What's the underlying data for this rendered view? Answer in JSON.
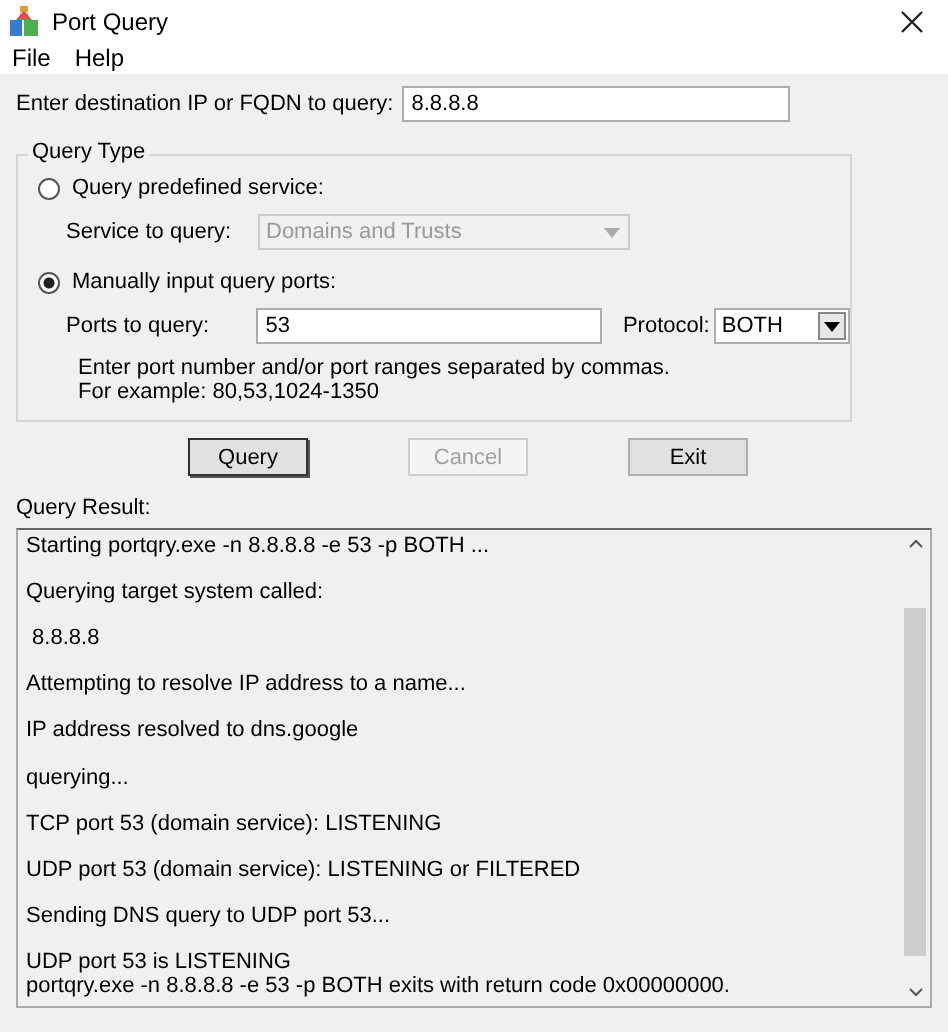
{
  "window": {
    "title": "Port Query"
  },
  "menu": [
    "File",
    "Help"
  ],
  "destination": {
    "label": "Enter destination IP or FQDN to query:",
    "value": "8.8.8.8"
  },
  "query_type": {
    "title": "Query Type",
    "options": [
      {
        "label": "Query predefined service:",
        "selected": false
      },
      {
        "label": "Manually input query ports:",
        "selected": true
      }
    ],
    "service": {
      "label": "Service to query:",
      "value": "Domains and Trusts",
      "disabled": true
    },
    "ports": {
      "label": "Ports to query:",
      "value": "53"
    },
    "protocol": {
      "label": "Protocol:",
      "value": "BOTH"
    },
    "hint": [
      "Enter port number and/or port ranges separated by commas.",
      "For example: 80,53,1024-1350"
    ]
  },
  "buttons": [
    {
      "label": "Query",
      "disabled": false
    },
    {
      "label": "Cancel",
      "disabled": true
    },
    {
      "label": "Exit",
      "disabled": false
    }
  ],
  "result": {
    "label": "Query Result:",
    "paragraphs": [
      [
        "Starting portqry.exe -n 8.8.8.8 -e 53 -p BOTH ..."
      ],
      [
        "Querying target system called:"
      ],
      [
        " 8.8.8.8"
      ],
      [
        "Attempting to resolve IP address to a name..."
      ],
      [
        "IP address resolved to dns.google"
      ],
      [
        "querying..."
      ],
      [
        "TCP port 53 (domain service): LISTENING"
      ],
      [
        "UDP port 53 (domain service): LISTENING or FILTERED"
      ],
      [
        "Sending DNS query to UDP port 53..."
      ],
      [
        "UDP port 53 is LISTENING",
        "portqry.exe -n 8.8.8.8 -e 53 -p BOTH exits with return code 0x00000000."
      ]
    ]
  }
}
